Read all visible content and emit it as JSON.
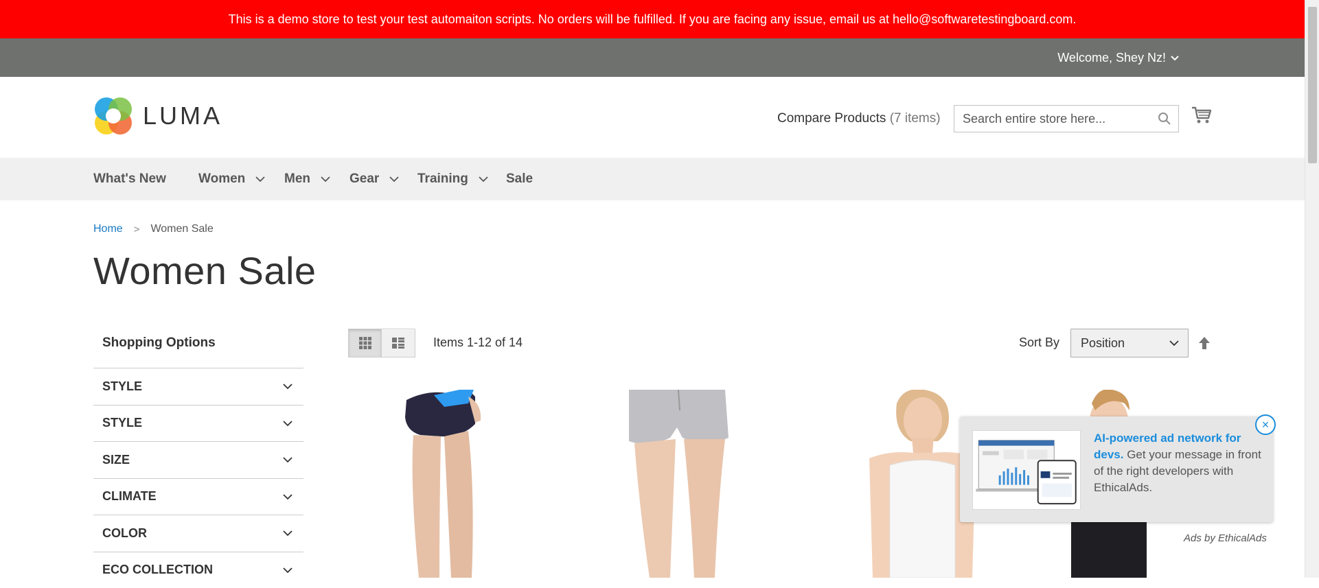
{
  "notice": {
    "text": "This is a demo store to test your test automaiton scripts. No orders will be fulfilled. If you are facing any issue, email us at hello@softwaretestingboard.com."
  },
  "header": {
    "welcome": "Welcome, Shey Nz!",
    "logo_text": "LUMA",
    "compare_label": "Compare Products",
    "compare_count": "(7 items)",
    "search_placeholder": "Search entire store here..."
  },
  "nav": [
    {
      "label": "What's New",
      "has_dropdown": false
    },
    {
      "label": "Women",
      "has_dropdown": true
    },
    {
      "label": "Men",
      "has_dropdown": true
    },
    {
      "label": "Gear",
      "has_dropdown": true
    },
    {
      "label": "Training",
      "has_dropdown": true
    },
    {
      "label": "Sale",
      "has_dropdown": false
    }
  ],
  "breadcrumbs": {
    "home": "Home",
    "separator": ">",
    "current": "Women Sale"
  },
  "page_title": "Women Sale",
  "sidebar": {
    "title": "Shopping Options",
    "filters": [
      "STYLE",
      "STYLE",
      "SIZE",
      "CLIMATE",
      "COLOR",
      "ECO COLLECTION"
    ]
  },
  "toolbar": {
    "amount": "Items 1-12 of 14",
    "sort_label": "Sort By",
    "sort_value": "Position"
  },
  "ad": {
    "headline": "AI-powered ad network for devs.",
    "body": " Get your message in front of the right developers with EthicalAds.",
    "byline": "Ads by EthicalAds",
    "close": "×"
  },
  "colors": {
    "notice_bg": "#ff0000",
    "panel_bg": "#6e716e",
    "nav_bg": "#f0f0f0",
    "link": "#1979c3",
    "ad_accent": "#1a8ddc"
  },
  "icons": [
    "chevron-down-icon",
    "search-icon",
    "cart-icon",
    "grid-icon",
    "list-icon",
    "arrow-up-icon",
    "close-icon"
  ]
}
